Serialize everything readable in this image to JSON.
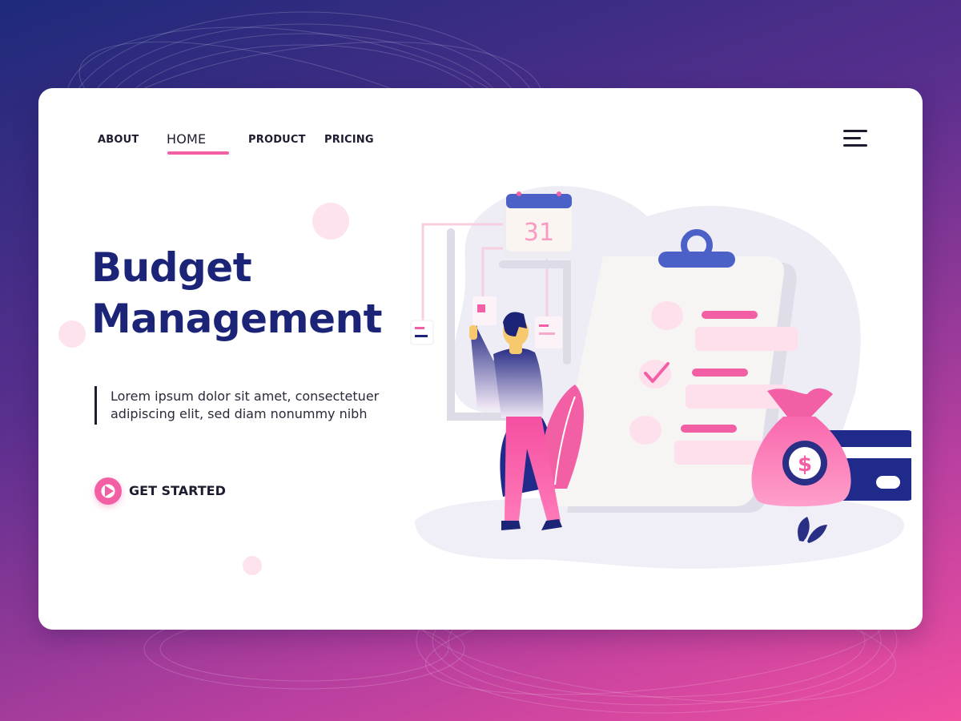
{
  "nav": {
    "items": [
      {
        "label": "ABOUT"
      },
      {
        "label": "HOME",
        "active": true
      },
      {
        "label": "PRODUCT"
      },
      {
        "label": "PRICING"
      }
    ],
    "menu_icon": "hamburger-menu-icon"
  },
  "hero": {
    "title_line1": "Budget",
    "title_line2": "Management",
    "description_line1": "Lorem ipsum dolor sit amet, consectetuer",
    "description_line2": "adipiscing elit, sed diam nonummy nibh",
    "cta_label": "GET STARTED",
    "cta_icon": "play-icon"
  },
  "illustration": {
    "calendar_day": "31",
    "currency_symbol": "$"
  },
  "colors": {
    "accent_pink": "#f25fa4",
    "navy": "#1c2478",
    "text_dark": "#1c1c2e"
  }
}
